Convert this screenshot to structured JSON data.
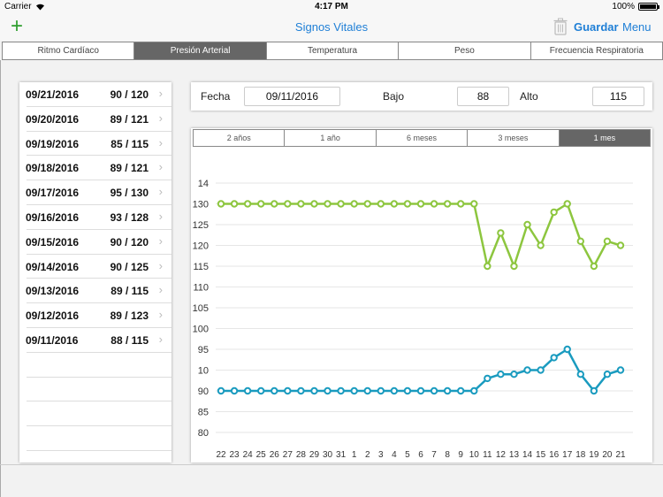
{
  "status": {
    "carrier": "Carrier",
    "time": "4:17 PM",
    "battery": "100%"
  },
  "nav": {
    "title": "Signos Vitales",
    "save_label": "Guardar",
    "menu_label": "Menu",
    "add_label": "+"
  },
  "colors": {
    "accent": "#1f7fd6",
    "high_series": "#8dc63f",
    "low_series": "#1a9bbf"
  },
  "tabs": [
    {
      "label": "Ritmo Cardíaco",
      "active": false
    },
    {
      "label": "Presión Arterial",
      "active": true
    },
    {
      "label": "Temperatura",
      "active": false
    },
    {
      "label": "Peso",
      "active": false
    },
    {
      "label": "Frecuencia Respiratoria",
      "active": false
    }
  ],
  "records": [
    {
      "date": "09/21/2016",
      "value": "90 / 120"
    },
    {
      "date": "09/20/2016",
      "value": "89 / 121"
    },
    {
      "date": "09/19/2016",
      "value": "85 / 115"
    },
    {
      "date": "09/18/2016",
      "value": "89 / 121"
    },
    {
      "date": "09/17/2016",
      "value": "95 / 130"
    },
    {
      "date": "09/16/2016",
      "value": "93 / 128"
    },
    {
      "date": "09/15/2016",
      "value": "90 / 120"
    },
    {
      "date": "09/14/2016",
      "value": "90 / 125"
    },
    {
      "date": "09/13/2016",
      "value": "89 / 115"
    },
    {
      "date": "09/12/2016",
      "value": "89 / 123"
    },
    {
      "date": "09/11/2016",
      "value": "88 / 115"
    }
  ],
  "form": {
    "date_label": "Fecha",
    "date_value": "09/11/2016",
    "low_label": "Bajo",
    "low_value": "88",
    "high_label": "Alto",
    "high_value": "115"
  },
  "range_tabs": [
    {
      "label": "2 años",
      "active": false
    },
    {
      "label": "1 año",
      "active": false
    },
    {
      "label": "6 meses",
      "active": false
    },
    {
      "label": "3 meses",
      "active": false
    },
    {
      "label": "1 mes",
      "active": true
    }
  ],
  "chart_data": {
    "type": "line",
    "x": [
      "22",
      "23",
      "24",
      "25",
      "26",
      "27",
      "28",
      "29",
      "30",
      "31",
      "1",
      "2",
      "3",
      "4",
      "5",
      "6",
      "7",
      "8",
      "9",
      "10",
      "11",
      "12",
      "13",
      "14",
      "15",
      "16",
      "17",
      "18",
      "19",
      "20",
      "21"
    ],
    "y_ticks": [
      "14",
      "130",
      "125",
      "120",
      "115",
      "110",
      "105",
      "100",
      "95",
      "10",
      "90",
      "85",
      "80"
    ],
    "ylim": [
      78,
      142
    ],
    "grid": true,
    "series": [
      {
        "values": [
          130,
          130,
          130,
          130,
          130,
          130,
          130,
          130,
          130,
          130,
          130,
          130,
          130,
          130,
          130,
          130,
          130,
          130,
          130,
          130,
          115,
          123,
          115,
          125,
          120,
          128,
          130,
          121,
          115,
          121,
          120
        ]
      },
      {
        "values": [
          85,
          85,
          85,
          85,
          85,
          85,
          85,
          85,
          85,
          85,
          85,
          85,
          85,
          85,
          85,
          85,
          85,
          85,
          85,
          85,
          88,
          89,
          89,
          90,
          90,
          93,
          95,
          89,
          85,
          89,
          90
        ]
      }
    ]
  }
}
